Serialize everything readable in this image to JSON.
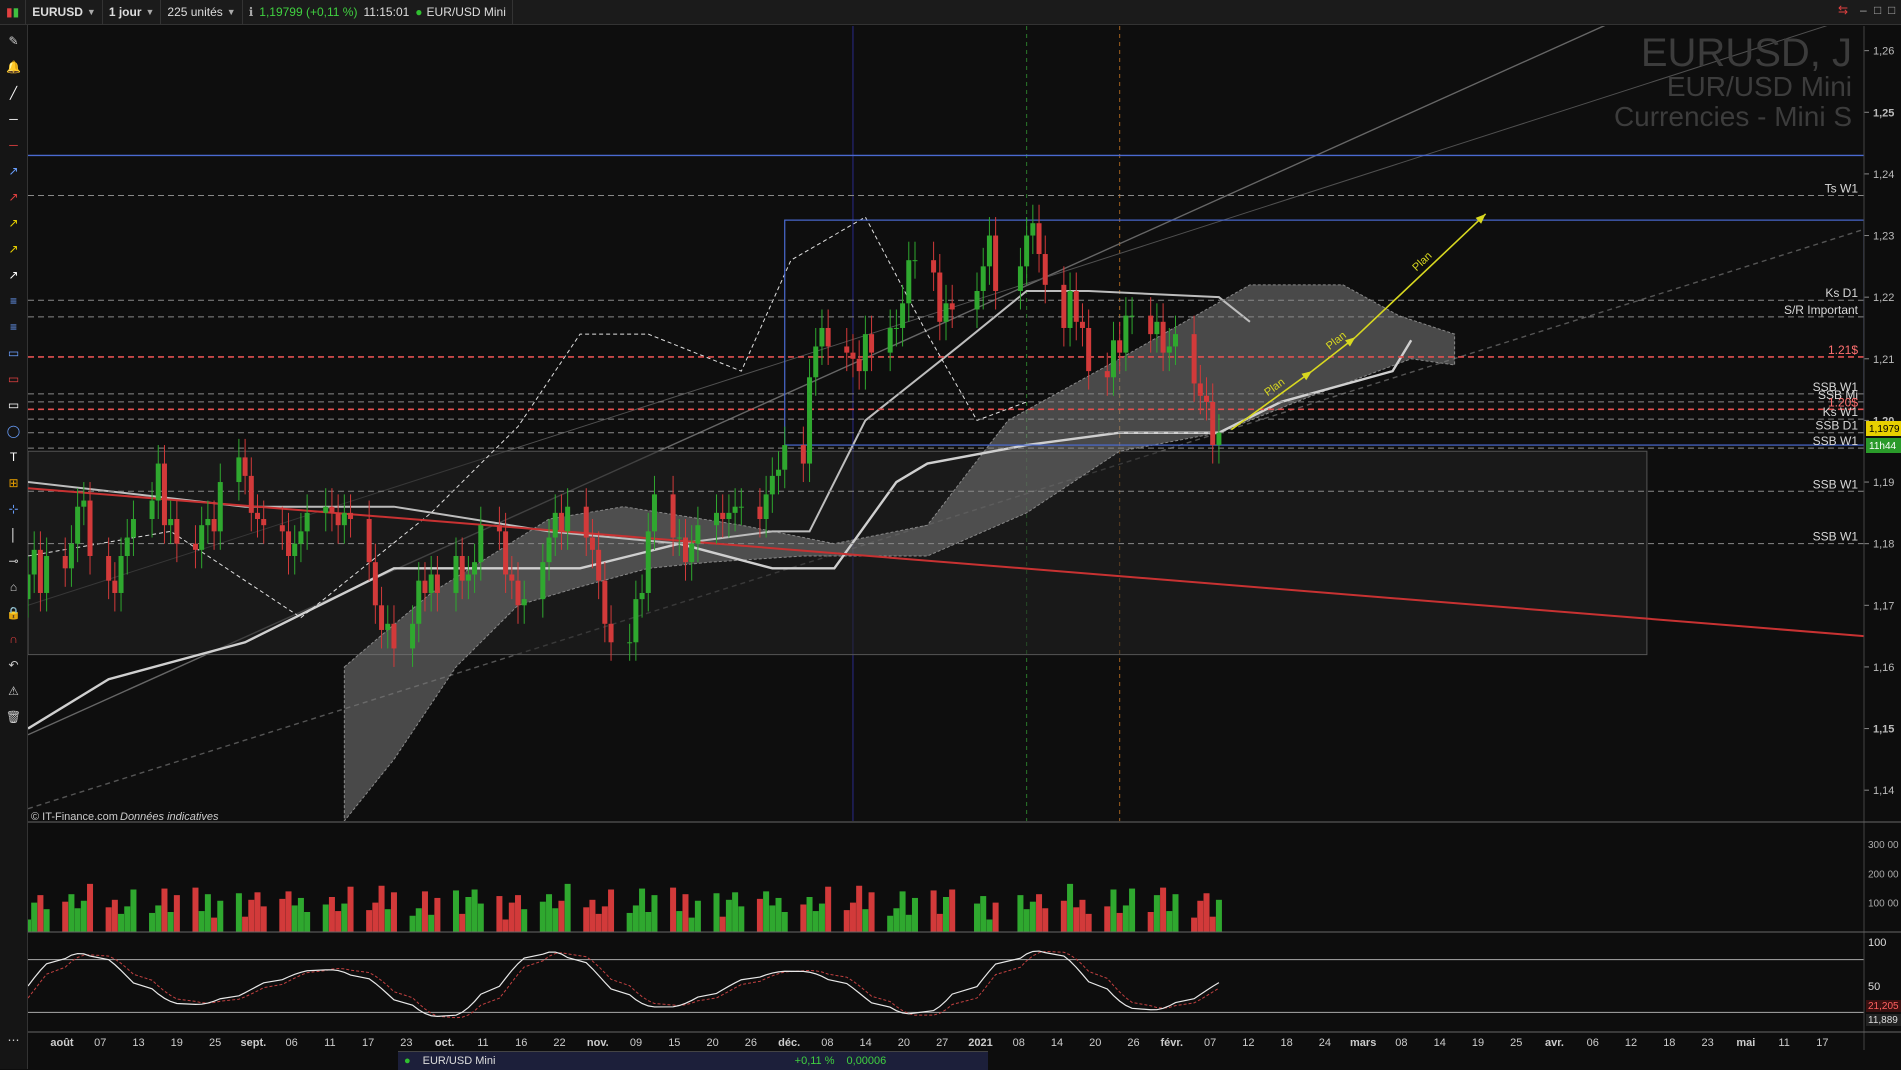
{
  "toolbar_top": {
    "symbol": "EURUSD",
    "interval": "1 jour",
    "units": "225 unités",
    "price_info": "1,19799 (+0,11 %)",
    "time": "11:15:01",
    "instrument": "EUR/USD Mini"
  },
  "watermark": {
    "line1": "EURUSD, J",
    "line2": "EUR/USD Mini",
    "line3": "Currencies - Mini S"
  },
  "credit": {
    "source": "© IT-Finance.com",
    "note": "Données indicatives"
  },
  "price_axis": {
    "ticks": [
      "1,26",
      "1,25",
      "1,24",
      "1,23",
      "1,22",
      "1,21",
      "1,20",
      "1,19",
      "1,18",
      "1,17",
      "1,16",
      "1,15",
      "1,14"
    ],
    "bold": [
      "1,25",
      "1,20",
      "1,15"
    ],
    "current_price": "1,1979",
    "countdown": "11h44"
  },
  "levels": [
    {
      "label": "Ts W1",
      "value": 1.2365,
      "color": "#888888",
      "style": "dashed"
    },
    {
      "label": "Ks D1",
      "value": 1.2195,
      "color": "#888888",
      "style": "dashed"
    },
    {
      "label": "S/R Important",
      "value": 1.2168,
      "color": "#888888",
      "style": "dashed"
    },
    {
      "label": "1.21$",
      "value": 1.2103,
      "color": "#e05050",
      "style": "dashed"
    },
    {
      "label": "SSB W1",
      "value": 1.2043,
      "color": "#888888",
      "style": "dashed"
    },
    {
      "label": "SSB Mi",
      "value": 1.203,
      "color": "#888888",
      "style": "dashed"
    },
    {
      "label": "1.20$",
      "value": 1.2018,
      "color": "#e05050",
      "style": "dashed"
    },
    {
      "label": "Ks W1",
      "value": 1.2002,
      "color": "#888888",
      "style": "dashed"
    },
    {
      "label": "SSB D1",
      "value": 1.198,
      "color": "#888888",
      "style": "dashed"
    },
    {
      "label": "SSB W1",
      "value": 1.1955,
      "color": "#888888",
      "style": "dashed"
    },
    {
      "label": "SSB W1",
      "value": 1.1885,
      "color": "#888888",
      "style": "dashed"
    },
    {
      "label": "SSB W1",
      "value": 1.18,
      "color": "#888888",
      "style": "dashed"
    }
  ],
  "plan_labels": [
    "Plan",
    "Plan",
    "Plan"
  ],
  "volume_axis": {
    "ticks": [
      "300 00",
      "200 00",
      "100 00"
    ]
  },
  "osc_axis": {
    "ticks": [
      "100",
      "50"
    ],
    "value1": "21,205",
    "value2": "11,889"
  },
  "date_axis": {
    "labels": [
      "août",
      "07",
      "13",
      "19",
      "25",
      "sept.",
      "06",
      "11",
      "17",
      "23",
      "oct.",
      "11",
      "16",
      "22",
      "nov.",
      "09",
      "15",
      "20",
      "26",
      "déc.",
      "08",
      "14",
      "20",
      "27",
      "2021",
      "08",
      "14",
      "20",
      "26",
      "févr.",
      "07",
      "12",
      "18",
      "24",
      "mars",
      "08",
      "14",
      "19",
      "25",
      "avr.",
      "06",
      "12",
      "18",
      "23",
      "mai",
      "11",
      "17"
    ],
    "bold": [
      "août",
      "sept.",
      "oct.",
      "nov.",
      "déc.",
      "2021",
      "févr.",
      "mars",
      "avr.",
      "mai"
    ]
  },
  "bottom_bar": {
    "instrument": "EUR/USD Mini",
    "change": "+0,11 %",
    "value": "0,00006"
  },
  "colors": {
    "bull": "#2fa82f",
    "bear": "#d23a3a",
    "cloud": "#7a7a7a",
    "blue_rect": "#4a6ad0",
    "trend_red": "#c83232",
    "plan_arrow": "#d8d820"
  },
  "chart_data": {
    "type": "candlestick",
    "title": "EURUSD, J",
    "subtitle": "EUR/USD Mini",
    "ylabel": "",
    "ylim": [
      1.135,
      1.264
    ],
    "x_range": [
      "2020-07-28",
      "2021-05-20"
    ],
    "current_price": 1.1979,
    "candles": [
      [
        "2020-07-28",
        1.171,
        1.175
      ],
      [
        "2020-07-29",
        1.175,
        1.179
      ],
      [
        "2020-07-30",
        1.179,
        1.172
      ],
      [
        "2020-07-31",
        1.172,
        1.178
      ],
      [
        "2020-08-03",
        1.178,
        1.176
      ],
      [
        "2020-08-04",
        1.176,
        1.18
      ],
      [
        "2020-08-05",
        1.18,
        1.186
      ],
      [
        "2020-08-06",
        1.186,
        1.187
      ],
      [
        "2020-08-07",
        1.187,
        1.178
      ],
      [
        "2020-08-10",
        1.178,
        1.174
      ],
      [
        "2020-08-11",
        1.174,
        1.172
      ],
      [
        "2020-08-12",
        1.172,
        1.178
      ],
      [
        "2020-08-13",
        1.178,
        1.181
      ],
      [
        "2020-08-14",
        1.181,
        1.184
      ],
      [
        "2020-08-17",
        1.184,
        1.187
      ],
      [
        "2020-08-18",
        1.187,
        1.193
      ],
      [
        "2020-08-19",
        1.193,
        1.183
      ],
      [
        "2020-08-20",
        1.183,
        1.184
      ],
      [
        "2020-08-21",
        1.184,
        1.18
      ],
      [
        "2020-08-24",
        1.18,
        1.179
      ],
      [
        "2020-08-25",
        1.179,
        1.183
      ],
      [
        "2020-08-26",
        1.183,
        1.184
      ],
      [
        "2020-08-27",
        1.184,
        1.182
      ],
      [
        "2020-08-28",
        1.182,
        1.19
      ],
      [
        "2020-08-31",
        1.19,
        1.194
      ],
      [
        "2020-09-01",
        1.194,
        1.191
      ],
      [
        "2020-09-02",
        1.191,
        1.185
      ],
      [
        "2020-09-03",
        1.185,
        1.184
      ],
      [
        "2020-09-04",
        1.184,
        1.183
      ],
      [
        "2020-09-07",
        1.183,
        1.182
      ],
      [
        "2020-09-08",
        1.182,
        1.178
      ],
      [
        "2020-09-09",
        1.178,
        1.18
      ],
      [
        "2020-09-10",
        1.18,
        1.182
      ],
      [
        "2020-09-11",
        1.182,
        1.185
      ],
      [
        "2020-09-14",
        1.185,
        1.186
      ],
      [
        "2020-09-15",
        1.186,
        1.185
      ],
      [
        "2020-09-16",
        1.185,
        1.183
      ],
      [
        "2020-09-17",
        1.183,
        1.185
      ],
      [
        "2020-09-18",
        1.185,
        1.184
      ],
      [
        "2020-09-21",
        1.184,
        1.177
      ],
      [
        "2020-09-22",
        1.177,
        1.17
      ],
      [
        "2020-09-23",
        1.17,
        1.166
      ],
      [
        "2020-09-24",
        1.166,
        1.167
      ],
      [
        "2020-09-25",
        1.167,
        1.163
      ],
      [
        "2020-09-28",
        1.163,
        1.167
      ],
      [
        "2020-09-29",
        1.167,
        1.174
      ],
      [
        "2020-09-30",
        1.174,
        1.172
      ],
      [
        "2020-10-01",
        1.172,
        1.175
      ],
      [
        "2020-10-02",
        1.175,
        1.172
      ],
      [
        "2020-10-05",
        1.172,
        1.178
      ],
      [
        "2020-10-06",
        1.178,
        1.174
      ],
      [
        "2020-10-07",
        1.174,
        1.175
      ],
      [
        "2020-10-08",
        1.175,
        1.177
      ],
      [
        "2020-10-09",
        1.177,
        1.183
      ],
      [
        "2020-10-12",
        1.183,
        1.182
      ],
      [
        "2020-10-13",
        1.182,
        1.175
      ],
      [
        "2020-10-14",
        1.175,
        1.174
      ],
      [
        "2020-10-15",
        1.174,
        1.17
      ],
      [
        "2020-10-16",
        1.17,
        1.171
      ],
      [
        "2020-10-19",
        1.171,
        1.177
      ],
      [
        "2020-10-20",
        1.177,
        1.181
      ],
      [
        "2020-10-21",
        1.181,
        1.185
      ],
      [
        "2020-10-22",
        1.185,
        1.182
      ],
      [
        "2020-10-23",
        1.182,
        1.186
      ],
      [
        "2020-10-26",
        1.186,
        1.181
      ],
      [
        "2020-10-27",
        1.181,
        1.179
      ],
      [
        "2020-10-28",
        1.179,
        1.174
      ],
      [
        "2020-10-29",
        1.174,
        1.167
      ],
      [
        "2020-10-30",
        1.167,
        1.164
      ],
      [
        "2020-11-02",
        1.164,
        1.164
      ],
      [
        "2020-11-03",
        1.164,
        1.171
      ],
      [
        "2020-11-04",
        1.171,
        1.172
      ],
      [
        "2020-11-05",
        1.172,
        1.182
      ],
      [
        "2020-11-06",
        1.182,
        1.188
      ],
      [
        "2020-11-09",
        1.188,
        1.181
      ],
      [
        "2020-11-10",
        1.181,
        1.181
      ],
      [
        "2020-11-11",
        1.181,
        1.177
      ],
      [
        "2020-11-12",
        1.177,
        1.18
      ],
      [
        "2020-11-13",
        1.18,
        1.183
      ],
      [
        "2020-11-16",
        1.183,
        1.185
      ],
      [
        "2020-11-17",
        1.185,
        1.184
      ],
      [
        "2020-11-18",
        1.184,
        1.185
      ],
      [
        "2020-11-19",
        1.185,
        1.186
      ],
      [
        "2020-11-20",
        1.186,
        1.186
      ],
      [
        "2020-11-23",
        1.186,
        1.184
      ],
      [
        "2020-11-24",
        1.184,
        1.188
      ],
      [
        "2020-11-25",
        1.188,
        1.191
      ],
      [
        "2020-11-26",
        1.191,
        1.192
      ],
      [
        "2020-11-27",
        1.192,
        1.196
      ],
      [
        "2020-11-30",
        1.196,
        1.193
      ],
      [
        "2020-12-01",
        1.193,
        1.207
      ],
      [
        "2020-12-02",
        1.207,
        1.212
      ],
      [
        "2020-12-03",
        1.212,
        1.215
      ],
      [
        "2020-12-04",
        1.215,
        1.212
      ],
      [
        "2020-12-07",
        1.212,
        1.211
      ],
      [
        "2020-12-08",
        1.211,
        1.21
      ],
      [
        "2020-12-09",
        1.21,
        1.208
      ],
      [
        "2020-12-10",
        1.208,
        1.214
      ],
      [
        "2020-12-11",
        1.214,
        1.211
      ],
      [
        "2020-12-14",
        1.211,
        1.215
      ],
      [
        "2020-12-15",
        1.215,
        1.215
      ],
      [
        "2020-12-16",
        1.215,
        1.219
      ],
      [
        "2020-12-17",
        1.219,
        1.226
      ],
      [
        "2020-12-18",
        1.226,
        1.226
      ],
      [
        "2020-12-21",
        1.226,
        1.224
      ],
      [
        "2020-12-22",
        1.224,
        1.216
      ],
      [
        "2020-12-23",
        1.216,
        1.219
      ],
      [
        "2020-12-24",
        1.219,
        1.218
      ],
      [
        "2020-12-28",
        1.218,
        1.221
      ],
      [
        "2020-12-29",
        1.221,
        1.225
      ],
      [
        "2020-12-30",
        1.225,
        1.23
      ],
      [
        "2020-12-31",
        1.23,
        1.221
      ],
      [
        "2021-01-04",
        1.221,
        1.225
      ],
      [
        "2021-01-05",
        1.225,
        1.23
      ],
      [
        "2021-01-06",
        1.23,
        1.232
      ],
      [
        "2021-01-07",
        1.232,
        1.227
      ],
      [
        "2021-01-08",
        1.227,
        1.222
      ],
      [
        "2021-01-11",
        1.222,
        1.215
      ],
      [
        "2021-01-12",
        1.215,
        1.221
      ],
      [
        "2021-01-13",
        1.221,
        1.216
      ],
      [
        "2021-01-14",
        1.216,
        1.215
      ],
      [
        "2021-01-15",
        1.215,
        1.208
      ],
      [
        "2021-01-18",
        1.208,
        1.207
      ],
      [
        "2021-01-19",
        1.207,
        1.213
      ],
      [
        "2021-01-20",
        1.213,
        1.211
      ],
      [
        "2021-01-21",
        1.211,
        1.217
      ],
      [
        "2021-01-22",
        1.217,
        1.217
      ],
      [
        "2021-01-25",
        1.217,
        1.214
      ],
      [
        "2021-01-26",
        1.214,
        1.216
      ],
      [
        "2021-01-27",
        1.216,
        1.211
      ],
      [
        "2021-01-28",
        1.211,
        1.212
      ],
      [
        "2021-01-29",
        1.212,
        1.214
      ],
      [
        "2021-02-01",
        1.214,
        1.206
      ],
      [
        "2021-02-02",
        1.206,
        1.204
      ],
      [
        "2021-02-03",
        1.204,
        1.203
      ],
      [
        "2021-02-04",
        1.203,
        1.196
      ],
      [
        "2021-02-05",
        1.196,
        1.198
      ]
    ],
    "volume_range": [
      0,
      320000
    ],
    "oscillator_range": [
      0,
      100
    ]
  }
}
